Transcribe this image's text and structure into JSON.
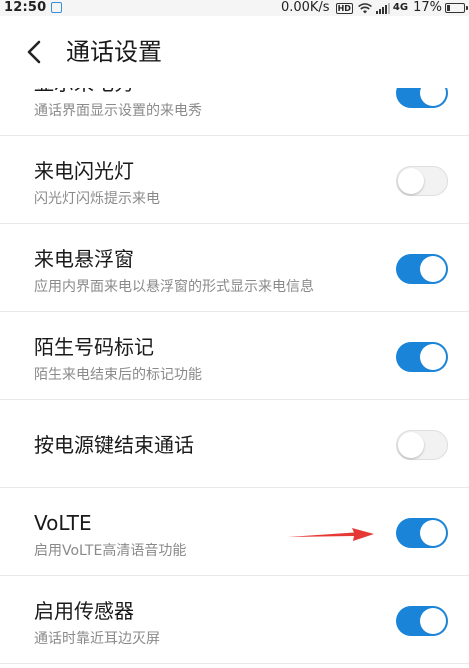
{
  "status_bar": {
    "time": "12:50",
    "network_speed": "0.00K/s",
    "hd_label": "HD",
    "network_type": "4G",
    "battery_percent": "17%",
    "battery_level": 0.17
  },
  "header": {
    "title": "通话设置",
    "back_icon": "chevron-left-icon"
  },
  "settings": [
    {
      "title": "显示来电秀",
      "description": "通话界面显示设置的来电秀",
      "enabled": true
    },
    {
      "title": "来电闪光灯",
      "description": "闪光灯闪烁提示来电",
      "enabled": false
    },
    {
      "title": "来电悬浮窗",
      "description": "应用内界面来电以悬浮窗的形式显示来电信息",
      "enabled": true
    },
    {
      "title": "陌生号码标记",
      "description": "陌生来电结束后的标记功能",
      "enabled": true
    },
    {
      "title": "按电源键结束通话",
      "description": "",
      "enabled": false
    },
    {
      "title": "VoLTE",
      "description": "启用VoLTE高清语音功能",
      "enabled": true
    },
    {
      "title": "启用传感器",
      "description": "通话时靠近耳边灭屏",
      "enabled": true
    }
  ],
  "colors": {
    "accent": "#1a84d8",
    "annotation": "#e53935"
  }
}
